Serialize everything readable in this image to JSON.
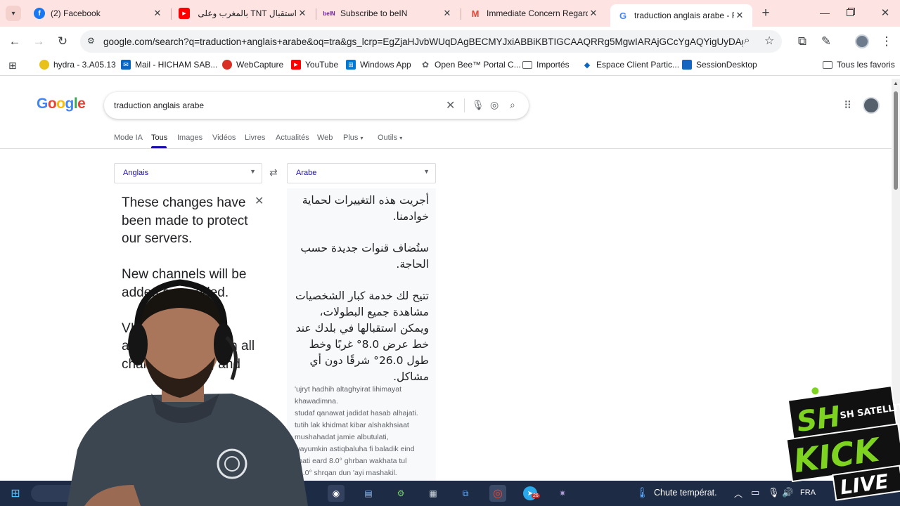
{
  "tabs": [
    {
      "title": "(2) Facebook",
      "icon": "facebook-icon",
      "color": "#1877f2"
    },
    {
      "title": "استقبال TNT بالمغرب وعلى ال",
      "icon": "youtube-icon",
      "color": "#ff0000"
    },
    {
      "title": "Subscribe to beIN",
      "icon": "bein-icon",
      "color": "#6a1b9a"
    },
    {
      "title": "Immediate Concern Regardi",
      "icon": "gmail-icon",
      "color": "#ea4335"
    },
    {
      "title": "traduction anglais arabe - R",
      "icon": "google-icon",
      "color": "#4285f4"
    }
  ],
  "address": {
    "url": "google.com/search?q=traduction+anglais+arabe&oq=tra&gs_lcrp=EgZjaHJvbWUqDAgBECMYJxiABBiKBTIGCAAQRRg5MgwIARAjGCcYgAQYigUyDAgCEC"
  },
  "bookmarks": [
    {
      "label": "hydra - 3.A05.13",
      "icon": "hydra-icon",
      "color": "#c8a400"
    },
    {
      "label": "Mail - HICHAM SAB...",
      "icon": "mail-icon",
      "color": "#0a66c2"
    },
    {
      "label": "WebCapture",
      "icon": "webcapture-icon",
      "color": "#d93025"
    },
    {
      "label": "YouTube",
      "icon": "youtube-icon",
      "color": "#ff0000"
    },
    {
      "label": "Windows App",
      "icon": "windows-icon",
      "color": "#0078d4"
    },
    {
      "label": "Open Bee™ Portal C...",
      "icon": "openbee-icon",
      "color": "#5f6368"
    },
    {
      "label": "Importés",
      "icon": "folder-icon",
      "color": "#5f6368"
    },
    {
      "label": "Espace Client Partic...",
      "icon": "espace-icon",
      "color": "#0a66c2"
    },
    {
      "label": "SessionDesktop",
      "icon": "session-icon",
      "color": "#1565c0"
    }
  ],
  "bookmarks_right": "Tous les favoris",
  "search": {
    "query": "traduction anglais arabe"
  },
  "search_tabs": [
    "Mode IA",
    "Tous",
    "Images",
    "Vidéos",
    "Livres",
    "Actualités",
    "Web",
    "Plus",
    "Outils"
  ],
  "selected_tab": "Tous",
  "translator": {
    "source_lang": "Anglais",
    "target_lang": "Arabe",
    "source_text": "These changes have been made to protect our servers.\n\nNew channels will be added as needed.\n\nVIP service\nallows you to watch all\nchampionships, and",
    "target_paragraphs": [
      "أجريت هذه التغييرات لحماية خوادمنا.",
      "ستُضاف قنوات جديدة حسب الحاجة.",
      "تتيح لك خدمة كبار الشخصيات مشاهدة جميع البطولات، ويمكن استقبالها في بلدك عند خط عرض 8.0° غربًا وخط طول 26.0° شرقًا دون أي مشاكل."
    ],
    "transliteration": "'ujryt hadhih altaghyirat lihimayat khawadimna.\nstudaf qanawat jadidat hasab alhajati.\ntutih lak khidmat kibar alshakhsiaat mushahadat jamie albutulati,\nwayumkin astiqbaluha fi baladik eind\nkhati eard 8.0° ghrban wakhata tul\n26.0° shrqan dun 'ayi mashakil."
  },
  "taskbar": {
    "weather_text": "Chute températ.",
    "lang": "FRA",
    "telegram_badge": "26",
    "search_partial": "pour"
  },
  "overlay_logo": {
    "line1": "SH",
    "line2": "SH SATELLITE",
    "line3": "KICK",
    "line4": "LIVE"
  }
}
